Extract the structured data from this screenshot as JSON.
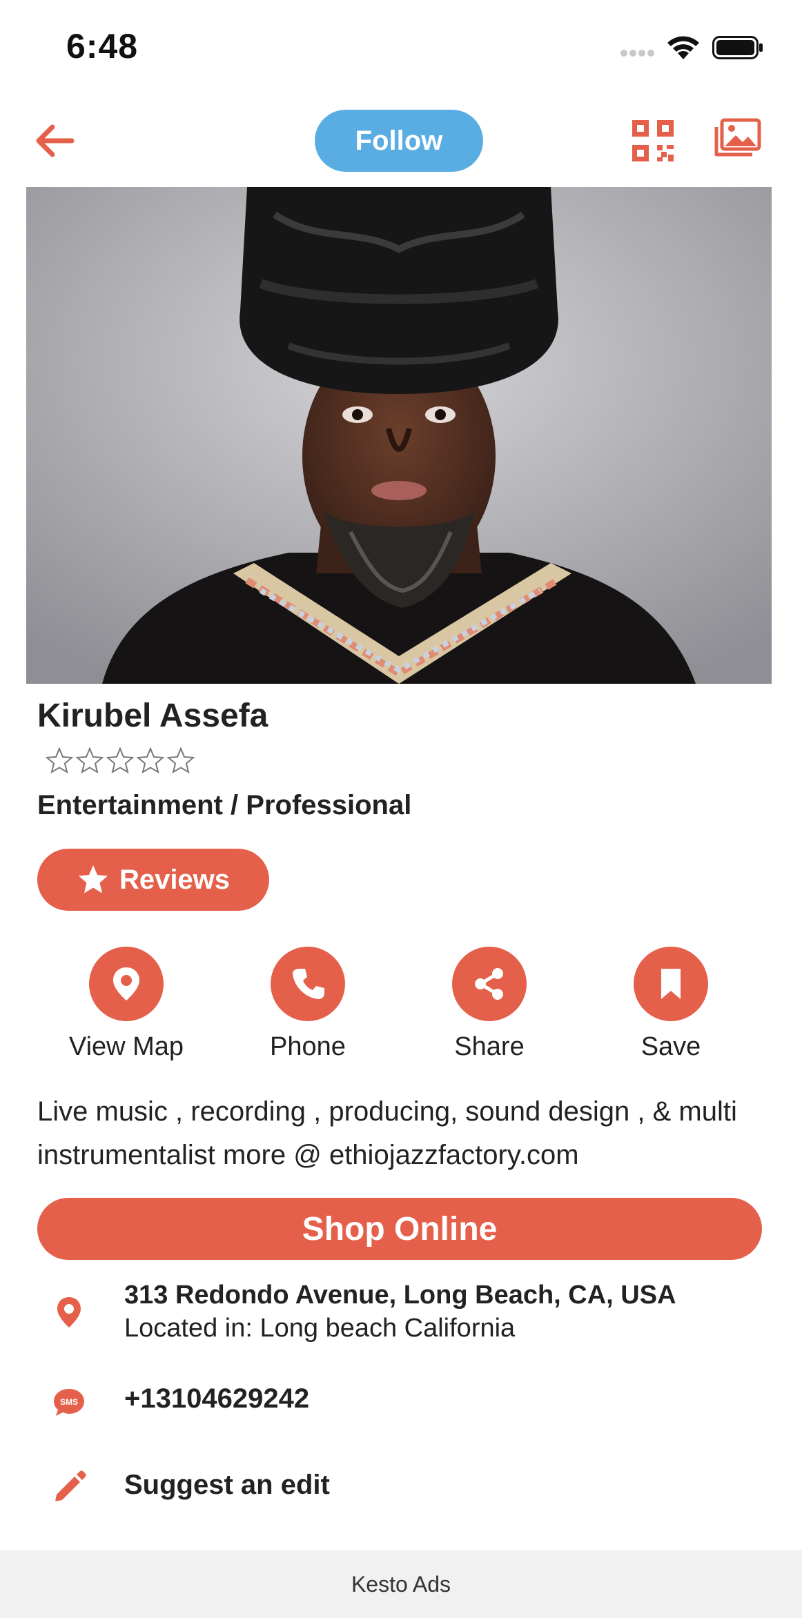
{
  "status_bar": {
    "time": "6:48"
  },
  "nav": {
    "follow_label": "Follow"
  },
  "profile": {
    "name": "Kirubel Assefa",
    "rating": {
      "value": 0,
      "max": 5
    },
    "category": "Entertainment / Professional"
  },
  "reviews_button": {
    "label": "Reviews"
  },
  "actions": [
    {
      "label": "View Map",
      "icon": "map-pin-icon"
    },
    {
      "label": "Phone",
      "icon": "phone-icon"
    },
    {
      "label": "Share",
      "icon": "share-icon"
    },
    {
      "label": "Save",
      "icon": "bookmark-icon"
    }
  ],
  "description": "Live music , recording ,  producing, sound design , & multi instrumentalist more @ ethiojazzfactory.com",
  "shop_button": {
    "label": "Shop Online"
  },
  "info": {
    "address_line1": "313 Redondo Avenue, Long Beach, CA, USA",
    "address_line2": "Located in: Long beach California",
    "phone": "+13104629242",
    "suggest_edit": "Suggest an edit"
  },
  "footer": {
    "ads_label": "Kesto Ads"
  },
  "colors": {
    "accent": "#e5604b",
    "follow": "#5aade3",
    "footer_bg": "#f1f1f1"
  }
}
